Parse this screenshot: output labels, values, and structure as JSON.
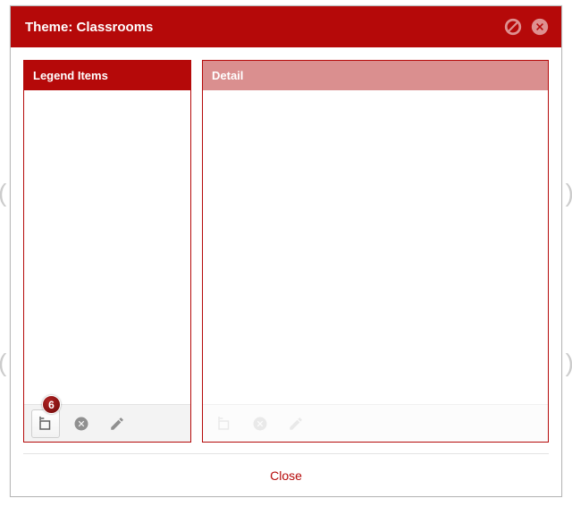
{
  "dialog": {
    "title": "Theme: Classrooms",
    "close_label": "Close"
  },
  "legend_panel": {
    "header": "Legend Items",
    "badge": "6"
  },
  "detail_panel": {
    "header": "Detail"
  },
  "colors": {
    "accent": "#b50909",
    "accent_light": "#da8f8f"
  }
}
